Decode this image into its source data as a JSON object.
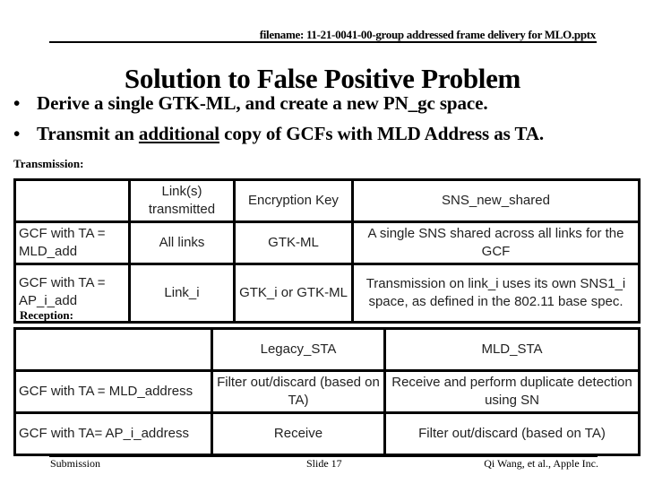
{
  "header": {
    "filename": "filename:  11-21-0041-00-group addressed frame delivery for MLO.pptx"
  },
  "title": "Solution to False Positive Problem",
  "bullets": [
    {
      "marker": "•",
      "text": "Derive a single GTK-ML, and create a new PN_gc space."
    },
    {
      "marker": "•",
      "text_before": "Transmit an ",
      "text_underlined": "additional",
      "text_after": " copy of GCFs with MLD Address as TA."
    }
  ],
  "transmission": {
    "label": "Transmission:",
    "columns": [
      "",
      "Link(s) transmitted",
      "Encryption Key",
      "SNS_new_shared"
    ],
    "rows": [
      {
        "frame": "GCF with TA = MLD_add",
        "links": "All links",
        "key": "GTK-ML",
        "sns": "A single SNS shared across all links for the GCF"
      },
      {
        "frame": "GCF with TA = AP_i_add",
        "links": "Link_i",
        "key": "GTK_i or GTK-ML",
        "sns": "Transmission on link_i uses its own SNS1_i space, as defined in the 802.11 base spec."
      }
    ]
  },
  "reception": {
    "label": "Reception:",
    "columns": [
      "",
      "Legacy_STA",
      "MLD_STA"
    ],
    "rows": [
      {
        "frame": "GCF with TA = MLD_address",
        "legacy": "Filter out/discard (based on TA)",
        "mld": "Receive and perform duplicate detection using SN"
      },
      {
        "frame": "GCF with TA= AP_i_address",
        "legacy": "Receive",
        "mld": "Filter out/discard (based on TA)"
      }
    ]
  },
  "footer": {
    "left": "Submission",
    "center": "Slide 17",
    "right": "Qi Wang, et al., Apple Inc."
  }
}
